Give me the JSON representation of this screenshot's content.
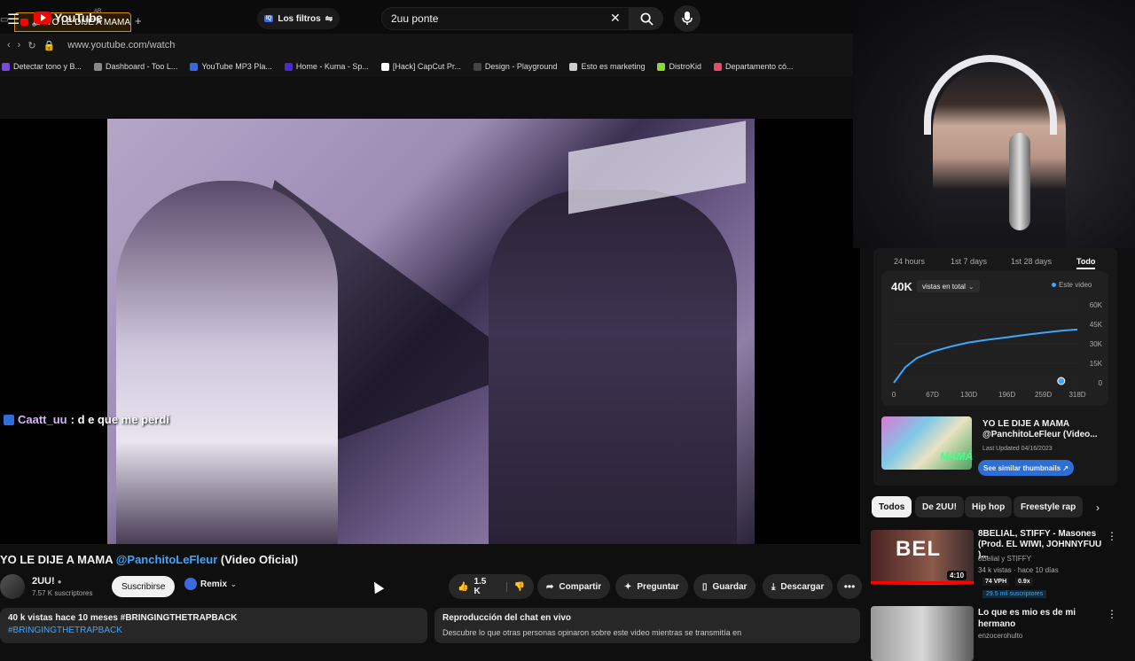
{
  "browser": {
    "tab_title": "YO LE DIJE A MAMA",
    "new_tab": "+",
    "url": "www.youtube.com/watch",
    "bookmarks": [
      {
        "label": "Detectar tono y B...",
        "color": "#7a4ad8"
      },
      {
        "label": "Dashboard - Too L...",
        "color": "#888888"
      },
      {
        "label": "YouTube MP3 Pla...",
        "color": "#3a6ad8"
      },
      {
        "label": "Home - Kuma - Sp...",
        "color": "#4a2ad8"
      },
      {
        "label": "[Hack] CapCut Pr...",
        "color": "#ffffff"
      },
      {
        "label": "Design - Playground",
        "color": "#444444"
      },
      {
        "label": "Esto es marketing",
        "color": "#cccccc"
      },
      {
        "label": "DistroKid",
        "color": "#8ad838"
      },
      {
        "label": "Departamento có...",
        "color": "#e84a6a"
      }
    ]
  },
  "header": {
    "logo_text": "YouTube",
    "country": "AR",
    "filters_label": "Los filtros",
    "filters_badge": "IQ",
    "search_value": "2uu ponte"
  },
  "player": {
    "chat_user": "Caatt_uu",
    "chat_message": ": d e que me perdí"
  },
  "video": {
    "title_prefix": "YO LE DIJE A MAMA ",
    "title_mention": "@PanchitoLeFleur",
    "title_suffix": " (Video Oficial)",
    "channel_name": "2UU!",
    "channel_subs": "7.57 K suscriptores",
    "subscribe_label": "Suscribirse",
    "remix_label": "Remix",
    "like_count": "1.5 K",
    "share_label": "Compartir",
    "ask_label": "Preguntar",
    "save_label": "Guardar",
    "download_label": "Descargar",
    "desc_stats": "40 k vistas  hace 10 meses  #BRINGINGTHETRAPBACK",
    "desc_hashtag": "#BRINGINGTHETRAPBACK",
    "chat_replay_title": "Reproducción del chat en vivo",
    "chat_replay_sub": "Descubre lo que otras personas opinaron sobre este video mientras se transmitía en"
  },
  "stats": {
    "ranges": [
      "24 hours",
      "1st 7 days",
      "1st 28 days",
      "Todo"
    ],
    "total": "40K",
    "total_select": "vistas en total",
    "legend": "Este video",
    "card_title": "YO LE DIJE A MAMA @PanchitoLeFleur (Video...",
    "card_updated": "Last Updated 04/16/2023",
    "similar_label": "See similar thumbnails ↗",
    "thumb_text": "MAMÁ"
  },
  "chart_data": {
    "type": "line",
    "x": [
      0,
      20,
      40,
      67,
      100,
      130,
      160,
      196,
      230,
      259,
      290,
      318
    ],
    "values": [
      0,
      12000,
      19000,
      24000,
      28000,
      31000,
      33000,
      35000,
      37000,
      38500,
      40000,
      41000
    ],
    "xticks": [
      "0",
      "67D",
      "130D",
      "196D",
      "259D",
      "318D"
    ],
    "yticks": [
      "0",
      "15K",
      "30K",
      "45K",
      "60K"
    ],
    "ylim": [
      0,
      60000
    ],
    "xlim": [
      0,
      318
    ],
    "series_name": "Este video",
    "color": "#3ea6ff"
  },
  "chips": [
    "Todos",
    "De 2UU!",
    "Hip hop",
    "Freestyle rap"
  ],
  "recommended": [
    {
      "thumb_text": "BEL",
      "duration": "4:10",
      "title": "8BELIAL, STIFFY - Masones (Prod. EL WIWI, JOHNNYFUU )...",
      "channel": "8Belial  y STIFFY",
      "meta": "34 k vistas · hace 10 días",
      "vph": "74 VPH",
      "ratio": "0.9x",
      "subs": "29.5 mil suscriptores"
    },
    {
      "title": "Lo que es mio es de mi hermano",
      "channel": "enzocerohulto"
    }
  ]
}
